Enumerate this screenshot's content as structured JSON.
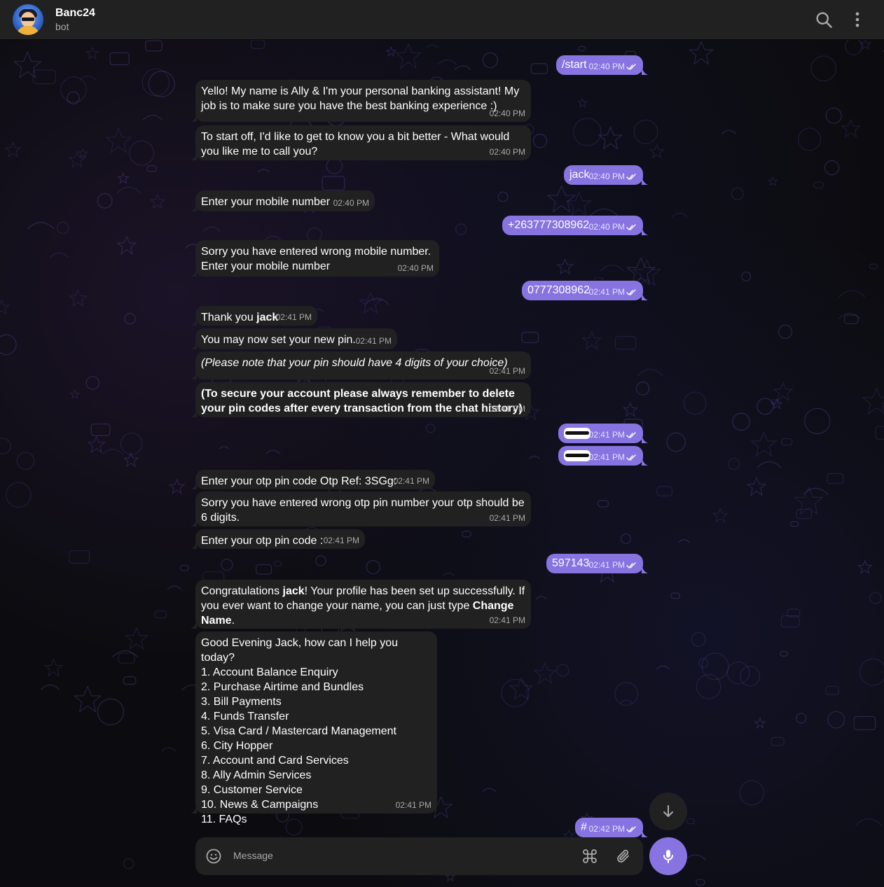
{
  "header": {
    "name": "Banc24",
    "status": "bot",
    "avatar_icon": "bot-avatar-icon",
    "search_icon": "search-icon",
    "menu_icon": "more-vertical-icon"
  },
  "colors": {
    "outgoing_bubble": "#8774e1",
    "incoming_bubble": "#212121",
    "header_bg": "#212121"
  },
  "messages": [
    {
      "dir": "out",
      "text": "/start",
      "time": "02:40 PM"
    },
    {
      "dir": "in",
      "text": "Yello! My name is Ally & I'm your personal banking assistant! My job is to make sure you have the best banking experience :)",
      "time": "02:40 PM"
    },
    {
      "dir": "in",
      "text": "To start off, I'd like to get to know you a bit better - What would you like me to call you?",
      "time": "02:40 PM"
    },
    {
      "dir": "out",
      "text": "jack",
      "time": "02:40 PM"
    },
    {
      "dir": "in",
      "text": "Enter your mobile number",
      "time": "02:40 PM"
    },
    {
      "dir": "out",
      "text": "+263777308962",
      "time": "02:40 PM"
    },
    {
      "dir": "in",
      "text": "Sorry you have entered wrong mobile number.\nEnter your mobile number",
      "time": "02:40 PM"
    },
    {
      "dir": "out",
      "text": "0777308962",
      "time": "02:41 PM"
    },
    {
      "dir": "in",
      "text_pre": "Thank you ",
      "text_bold": "jack",
      "time": "02:41 PM"
    },
    {
      "dir": "in",
      "text": "You may now set your new pin.",
      "time": "02:41 PM"
    },
    {
      "dir": "in",
      "text": "(Please note that your pin should have 4 digits of your choice)",
      "time": "02:41 PM"
    },
    {
      "dir": "in",
      "text": "(To secure your account please always remember to delete your pin codes after every transaction from the chat history)",
      "time": "02:41 PM"
    },
    {
      "dir": "out",
      "text": "",
      "redacted": true,
      "time": "02:41 PM"
    },
    {
      "dir": "out",
      "text": "",
      "redacted": true,
      "time": "02:41 PM"
    },
    {
      "dir": "in",
      "text": "Enter your otp pin code Otp Ref: 3SGg:",
      "time": "02:41 PM"
    },
    {
      "dir": "in",
      "text": "Sorry you have entered wrong otp pin number your otp should be 6 digits.",
      "time": "02:41 PM"
    },
    {
      "dir": "in",
      "text": "Enter your otp pin code :",
      "time": "02:41 PM"
    },
    {
      "dir": "out",
      "text": "597143",
      "time": "02:41 PM"
    },
    {
      "dir": "in",
      "text_p1": "Congratulations ",
      "text_b1": "jack",
      "text_p2": "! Your profile has been set up successfully. If you ever want to change your name, you can just type ",
      "text_b2": "Change Name",
      "text_p3": ".",
      "time": "02:41 PM"
    },
    {
      "dir": "in",
      "text": "Good Evening Jack, how can I help you today?\n1. Account Balance Enquiry\n2. Purchase Airtime and Bundles\n3. Bill Payments\n4. Funds Transfer\n5. Visa Card / Mastercard Management\n6. City Hopper\n7. Account and Card Services\n8. Ally Admin Services\n9. Customer Service\n10. News & Campaigns\n11. FAQs",
      "time": "02:41 PM"
    },
    {
      "dir": "out",
      "text": "#",
      "time": "02:42 PM"
    }
  ],
  "composer": {
    "placeholder": "Message",
    "emoji_icon": "emoji-icon",
    "command_icon": "command-icon",
    "attach_icon": "paperclip-icon",
    "mic_icon": "microphone-icon",
    "scroll_icon": "arrow-down-icon"
  }
}
